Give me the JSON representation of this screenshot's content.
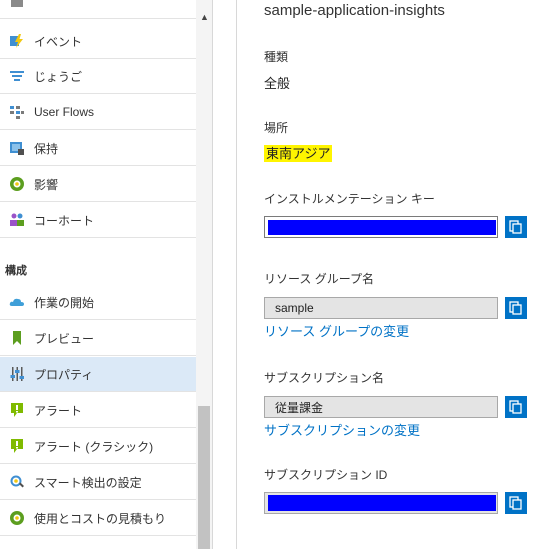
{
  "nav": {
    "items": [
      {
        "label": "イベント",
        "icon": "lightning-events-icon"
      },
      {
        "label": "じょうご",
        "icon": "funnel-icon"
      },
      {
        "label": "User Flows",
        "icon": "user-flows-icon"
      },
      {
        "label": "保持",
        "icon": "retention-icon"
      },
      {
        "label": "影響",
        "icon": "impact-icon"
      },
      {
        "label": "コーホート",
        "icon": "cohorts-icon"
      },
      {
        "label": "作業の開始",
        "icon": "cloud-getting-started-icon"
      },
      {
        "label": "プレビュー",
        "icon": "bookmark-preview-icon"
      },
      {
        "label": "プロパティ",
        "icon": "sliders-properties-icon"
      },
      {
        "label": "アラート",
        "icon": "alert-icon"
      },
      {
        "label": "アラート (クラシック)",
        "icon": "alert-classic-icon"
      },
      {
        "label": "スマート検出の設定",
        "icon": "smart-detection-icon"
      },
      {
        "label": "使用とコストの見積もり",
        "icon": "usage-cost-icon"
      }
    ],
    "section_header": "構成",
    "active_item": "プロパティ"
  },
  "panel": {
    "app_name": "sample-application-insights",
    "type_label": "種類",
    "type_value": "全般",
    "location_label": "場所",
    "location_value": "東南アジア",
    "ikey_label": "インストルメンテーション キー",
    "rg_label": "リソース グループ名",
    "rg_value": "sample",
    "rg_link": "リソース グループの変更",
    "sub_label": "サブスクリプション名",
    "sub_value": "従量課金",
    "sub_link": "サブスクリプションの変更",
    "subid_label": "サブスクリプション ID"
  },
  "colors": {
    "accent": "#0072c6",
    "highlight": "#fff500",
    "redaction": "#0000ff",
    "active_nav": "#dbe9f7"
  }
}
